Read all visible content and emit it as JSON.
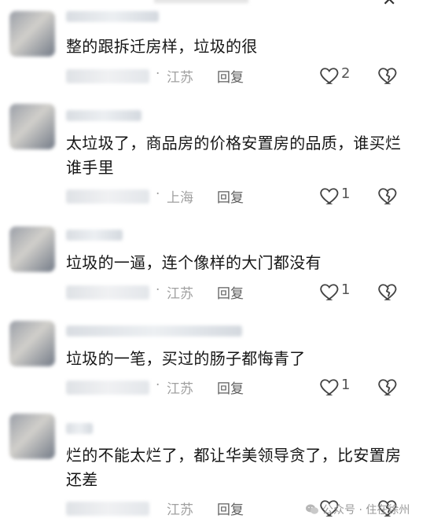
{
  "comments": [
    {
      "text": "整的跟拆迁房样，垃圾的很",
      "location": "江苏",
      "reply": "回复",
      "likes": "2"
    },
    {
      "text": "太垃圾了，商品房的价格安置房的品质，谁买烂谁手里",
      "location": "上海",
      "reply": "回复",
      "likes": "1"
    },
    {
      "text": "垃圾的一逼，连个像样的大门都没有",
      "location": "江苏",
      "reply": "回复",
      "likes": "1"
    },
    {
      "text": "垃圾的一笔，买过的肠子都悔青了",
      "location": "江苏",
      "reply": "回复",
      "likes": "1"
    },
    {
      "text": "烂的不能太烂了，都让华美领导贪了，比安置房还差",
      "location": "江苏",
      "reply": "回复",
      "likes": ""
    }
  ],
  "meta_separator": "·",
  "watermark": {
    "label": "公众号 · 住在徐州"
  },
  "icons": {
    "like": "heart-icon",
    "dislike": "broken-heart-icon",
    "close": "close-icon",
    "watermark": "wechat-icon"
  }
}
